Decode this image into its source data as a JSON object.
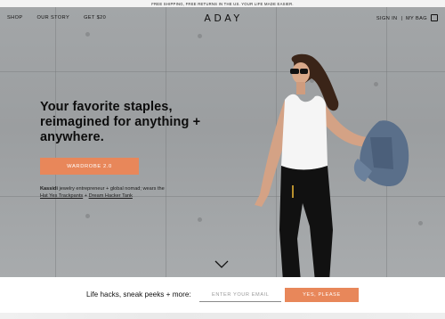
{
  "announcement": "FREE SHIPPING, FREE RETURNS IN THE US. YOUR LIFE MADE EASIER.",
  "nav": {
    "left": [
      {
        "label": "SHOP"
      },
      {
        "label": "OUR STORY"
      },
      {
        "label": "GET $20"
      }
    ],
    "logo": "ADAY",
    "sign_in": "SIGN IN",
    "separator": "|",
    "bag": "MY BAG"
  },
  "hero": {
    "headline": "Your favorite staples, reimagined for anything + anywhere.",
    "cta_label": "WARDROBE 2.0",
    "credit": {
      "name": "Kassidi",
      "description": " jewelry entrepreneur + global nomad; wears the",
      "link1": "Hat Yes Trackpants",
      "connector": " + ",
      "link2": "Dream Hacker Tank"
    }
  },
  "newsletter": {
    "label": "Life hacks, sneak peeks + more:",
    "placeholder": "ENTER YOUR EMAIL",
    "button": "YES, PLEASE"
  },
  "colors": {
    "accent": "#e8875a",
    "hero_bg": "#a0a3a5"
  },
  "icons": {
    "bag": "bag-icon",
    "scroll": "chevron-down-icon"
  }
}
